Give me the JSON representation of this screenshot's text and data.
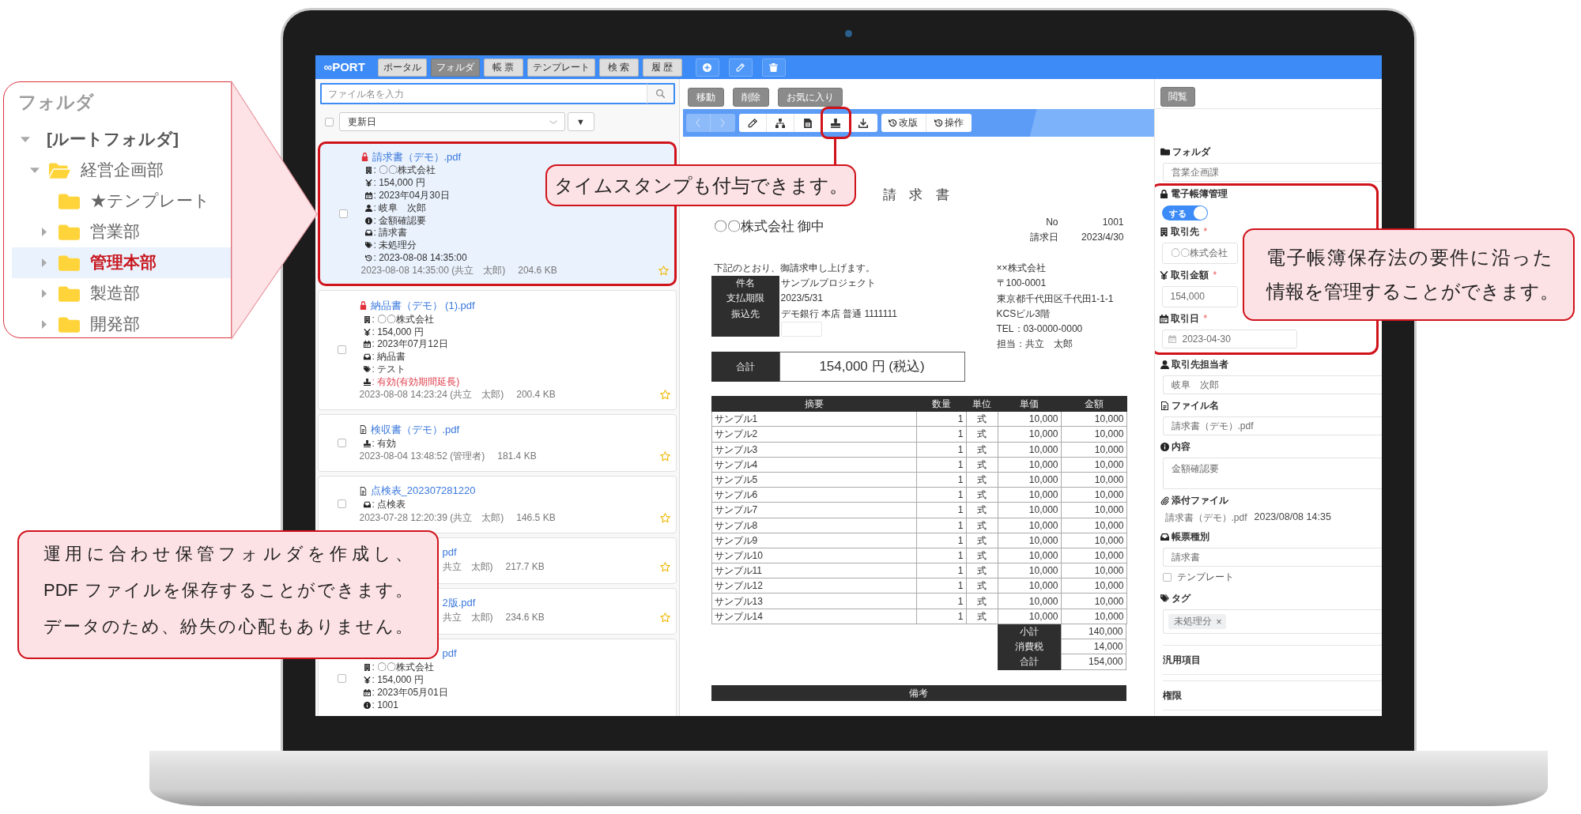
{
  "folder_panel": {
    "title": "フォルダ",
    "tree": [
      {
        "kind": "root",
        "label": "[ルートフォルダ]",
        "expanded": true,
        "selected": false,
        "children": [
          {
            "kind": "folder",
            "label": "経営企画部",
            "expanded": true,
            "selected": false,
            "children": [
              {
                "kind": "folder",
                "label": "★テンプレート",
                "selected": false
              },
              {
                "kind": "folder",
                "label": "営業部",
                "expanded": false,
                "selected": false
              },
              {
                "kind": "folder",
                "label": "管理本部",
                "expanded": false,
                "selected": true
              },
              {
                "kind": "folder",
                "label": "製造部",
                "expanded": false,
                "selected": false
              },
              {
                "kind": "folder",
                "label": "開発部",
                "expanded": false,
                "selected": false
              }
            ]
          }
        ]
      }
    ]
  },
  "app": {
    "logo": "∞PORT",
    "nav_tabs": [
      {
        "label": "ポータル",
        "selected": false
      },
      {
        "label": "フォルダ",
        "selected": true
      },
      {
        "label": "帳 票",
        "selected": false
      },
      {
        "label": "テンプレート",
        "selected": false
      },
      {
        "label": "検 索",
        "selected": false
      },
      {
        "label": "履 歴",
        "selected": false
      }
    ],
    "nav_actions": [
      {
        "kind": "add"
      },
      {
        "kind": "edit"
      },
      {
        "kind": "delete"
      }
    ],
    "file_search": {
      "placeholder": "ファイル名を入力"
    },
    "sort": {
      "checked": false,
      "field": "更新日",
      "order": "▼"
    },
    "files": [
      {
        "title": "請求書（デモ）.pdf",
        "locked": true,
        "selected": true,
        "highlighted": true,
        "covered": false,
        "checked": false,
        "starred": false,
        "lines": [
          {
            "kind": "client",
            "text": ": 〇〇株式会社",
            "alert": false
          },
          {
            "kind": "amount",
            "text": ": 154,000 円",
            "alert": false
          },
          {
            "kind": "date",
            "text": ": 2023年04月30日",
            "alert": false
          },
          {
            "kind": "person",
            "text": ": 岐阜　次郎",
            "alert": false
          },
          {
            "kind": "content",
            "text": ": 金額確認要",
            "alert": false
          },
          {
            "kind": "doc_type",
            "text": ": 請求書",
            "alert": false
          },
          {
            "kind": "tag",
            "text": ": 未処理分",
            "alert": false
          },
          {
            "kind": "timestamp",
            "text": ": 2023-08-08 14:35:00",
            "alert": false
          }
        ],
        "modified": "2023-08-08 14:35:00 (共立　太郎)",
        "size": "204.6 KB"
      },
      {
        "title": "納品書（デモ） (1).pdf",
        "locked": true,
        "selected": false,
        "highlighted": false,
        "covered": false,
        "checked": false,
        "starred": false,
        "lines": [
          {
            "kind": "client",
            "text": ": 〇〇株式会社",
            "alert": false
          },
          {
            "kind": "amount",
            "text": ": 154,000 円",
            "alert": false
          },
          {
            "kind": "date",
            "text": ": 2023年07月12日",
            "alert": false
          },
          {
            "kind": "doc_type",
            "text": ": 納品書",
            "alert": false
          },
          {
            "kind": "tag",
            "text": ": テスト",
            "alert": false
          },
          {
            "kind": "stamp",
            "text": ": 有効(有効期間延長)",
            "alert": true
          }
        ],
        "modified": "2023-08-08 14:23:24 (共立　太郎)",
        "size": "200.4 KB"
      },
      {
        "title": "検収書（デモ）.pdf",
        "locked": false,
        "selected": false,
        "highlighted": false,
        "covered": false,
        "checked": false,
        "starred": false,
        "lines": [
          {
            "kind": "stamp",
            "text": ": 有効",
            "alert": false
          }
        ],
        "modified": "2023-08-04 13:48:52 (管理者)",
        "size": "181.4 KB"
      },
      {
        "title": "点検表_202307281220",
        "locked": false,
        "selected": false,
        "highlighted": false,
        "covered": false,
        "checked": false,
        "starred": false,
        "lines": [
          {
            "kind": "doc_type",
            "text": ": 点検表",
            "alert": false
          }
        ],
        "modified": "2023-07-28 12:20:39 (共立　太郎)",
        "size": "146.5 KB"
      },
      {
        "title": "pdf",
        "selected": false,
        "highlighted": false,
        "covered": true,
        "starred": false,
        "modified": "共立　太郎)",
        "size": "217.7 KB"
      },
      {
        "title": "2版.pdf",
        "selected": false,
        "highlighted": false,
        "covered": true,
        "starred": false,
        "modified": "共立　太郎)",
        "size": "234.6 KB"
      },
      {
        "title": "pdf",
        "selected": false,
        "highlighted": false,
        "covered": true,
        "checked": false,
        "lines": [
          {
            "kind": "client",
            "text": ": 〇〇株式会社",
            "alert": false
          },
          {
            "kind": "amount",
            "text": ": 154,000 円",
            "alert": false
          },
          {
            "kind": "date",
            "text": ": 2023年05月01日",
            "alert": false
          },
          {
            "kind": "content",
            "text": ": 1001",
            "alert": false
          }
        ]
      }
    ],
    "file_actions": [
      "移動",
      "削除",
      "お気に入り"
    ],
    "toolbar": {
      "nav": [
        {
          "kind": "prev",
          "disabled": true
        },
        {
          "kind": "next",
          "disabled": true
        }
      ],
      "tools": [
        {
          "kind": "edit",
          "highlighted": false
        },
        {
          "kind": "structure",
          "highlighted": false
        },
        {
          "kind": "file",
          "highlighted": false
        },
        {
          "kind": "stamp",
          "highlighted": true
        },
        {
          "kind": "download",
          "highlighted": false
        }
      ],
      "history": [
        "改版",
        "操作"
      ]
    },
    "document": {
      "title": "請 求 書",
      "recipient": "〇〇株式会社 御中",
      "meta": [
        {
          "label": "No",
          "value": "1001"
        },
        {
          "label": "請求日",
          "value": "2023/4/30"
        }
      ],
      "intro": "下記のとおり、御請求申し上げます。",
      "details": [
        {
          "label": "件名",
          "value": "サンプルプロジェクト"
        },
        {
          "label": "支払期限",
          "value": "2023/5/31"
        },
        {
          "label": "振込先",
          "value": "デモ銀行 本店 普通 1111111"
        }
      ],
      "issuer": [
        "××株式会社",
        "〒100-0001",
        "東京都千代田区千代田1-1-1",
        "KCSビル3階",
        "TEL：03-0000-0000",
        "担当：共立　太郎"
      ],
      "total": {
        "label": "合計",
        "value": "154,000 円 (税込)"
      },
      "items_table": {
        "columns": [
          "摘要",
          "数量",
          "単位",
          "単価",
          "金額"
        ],
        "rows": [
          [
            "サンプル1",
            "1",
            "式",
            "10,000",
            "10,000"
          ],
          [
            "サンプル2",
            "1",
            "式",
            "10,000",
            "10,000"
          ],
          [
            "サンプル3",
            "1",
            "式",
            "10,000",
            "10,000"
          ],
          [
            "サンプル4",
            "1",
            "式",
            "10,000",
            "10,000"
          ],
          [
            "サンプル5",
            "1",
            "式",
            "10,000",
            "10,000"
          ],
          [
            "サンプル6",
            "1",
            "式",
            "10,000",
            "10,000"
          ],
          [
            "サンプル7",
            "1",
            "式",
            "10,000",
            "10,000"
          ],
          [
            "サンプル8",
            "1",
            "式",
            "10,000",
            "10,000"
          ],
          [
            "サンプル9",
            "1",
            "式",
            "10,000",
            "10,000"
          ],
          [
            "サンプル10",
            "1",
            "式",
            "10,000",
            "10,000"
          ],
          [
            "サンプル11",
            "1",
            "式",
            "10,000",
            "10,000"
          ],
          [
            "サンプル12",
            "1",
            "式",
            "10,000",
            "10,000"
          ],
          [
            "サンプル13",
            "1",
            "式",
            "10,000",
            "10,000"
          ],
          [
            "サンプル14",
            "1",
            "式",
            "10,000",
            "10,000"
          ]
        ]
      },
      "summary": [
        {
          "label": "小計",
          "value": "140,000"
        },
        {
          "label": "消費税",
          "value": "14,000"
        },
        {
          "label": "合計",
          "value": "154,000"
        }
      ],
      "remarks": "備考"
    },
    "properties": {
      "view_button": "閲覧",
      "sections": [
        {
          "kind": "folder",
          "label": "フォルダ",
          "value": "営業企画課"
        },
        {
          "kind": "ledger",
          "label": "電子帳簿管理",
          "highlighted": true,
          "toggle": {
            "label": "する",
            "on": true
          },
          "fields": [
            {
              "kind": "client",
              "label": "取引先",
              "mark": "*",
              "value": "〇〇株式会社"
            },
            {
              "kind": "amount",
              "label": "取引金額",
              "mark": "*",
              "value": "154,000"
            },
            {
              "kind": "date",
              "label": "取引日",
              "mark": "*",
              "value": "2023-04-30"
            }
          ]
        },
        {
          "kind": "person",
          "label": "取引先担当者",
          "value": "岐阜　次郎"
        },
        {
          "kind": "file",
          "label": "ファイル名",
          "value": "請求書（デモ）.pdf"
        },
        {
          "kind": "content",
          "label": "内容",
          "value": "金額確認要"
        },
        {
          "kind": "attachment",
          "label": "添付ファイル",
          "file": "請求書（デモ）.pdf",
          "date": "2023/08/08 14:35"
        },
        {
          "kind": "doc_type",
          "label": "帳票種別",
          "value": "請求書"
        },
        {
          "kind": "checkbox",
          "label": "テンプレート",
          "checked": false
        },
        {
          "kind": "tags",
          "label": "タグ",
          "tags": [
            {
              "label": "未処理分",
              "remove": "×"
            }
          ]
        },
        {
          "kind": "group",
          "label": "汎用項目"
        },
        {
          "kind": "group",
          "label": "権限"
        }
      ]
    }
  },
  "callouts": [
    {
      "kind": "toolbar",
      "lines": [
        "タイムスタンプも付与できます。"
      ]
    },
    {
      "kind": "ledger",
      "lines": [
        "電子帳簿保存法の要件に沿った",
        "情報を管理することができます。"
      ]
    },
    {
      "kind": "folder",
      "lines": [
        "運用に合わせ保管フォルダを作成し、",
        "PDF ファイルを保存することができます。",
        "データのため、紛失の心配もありません。"
      ]
    }
  ]
}
